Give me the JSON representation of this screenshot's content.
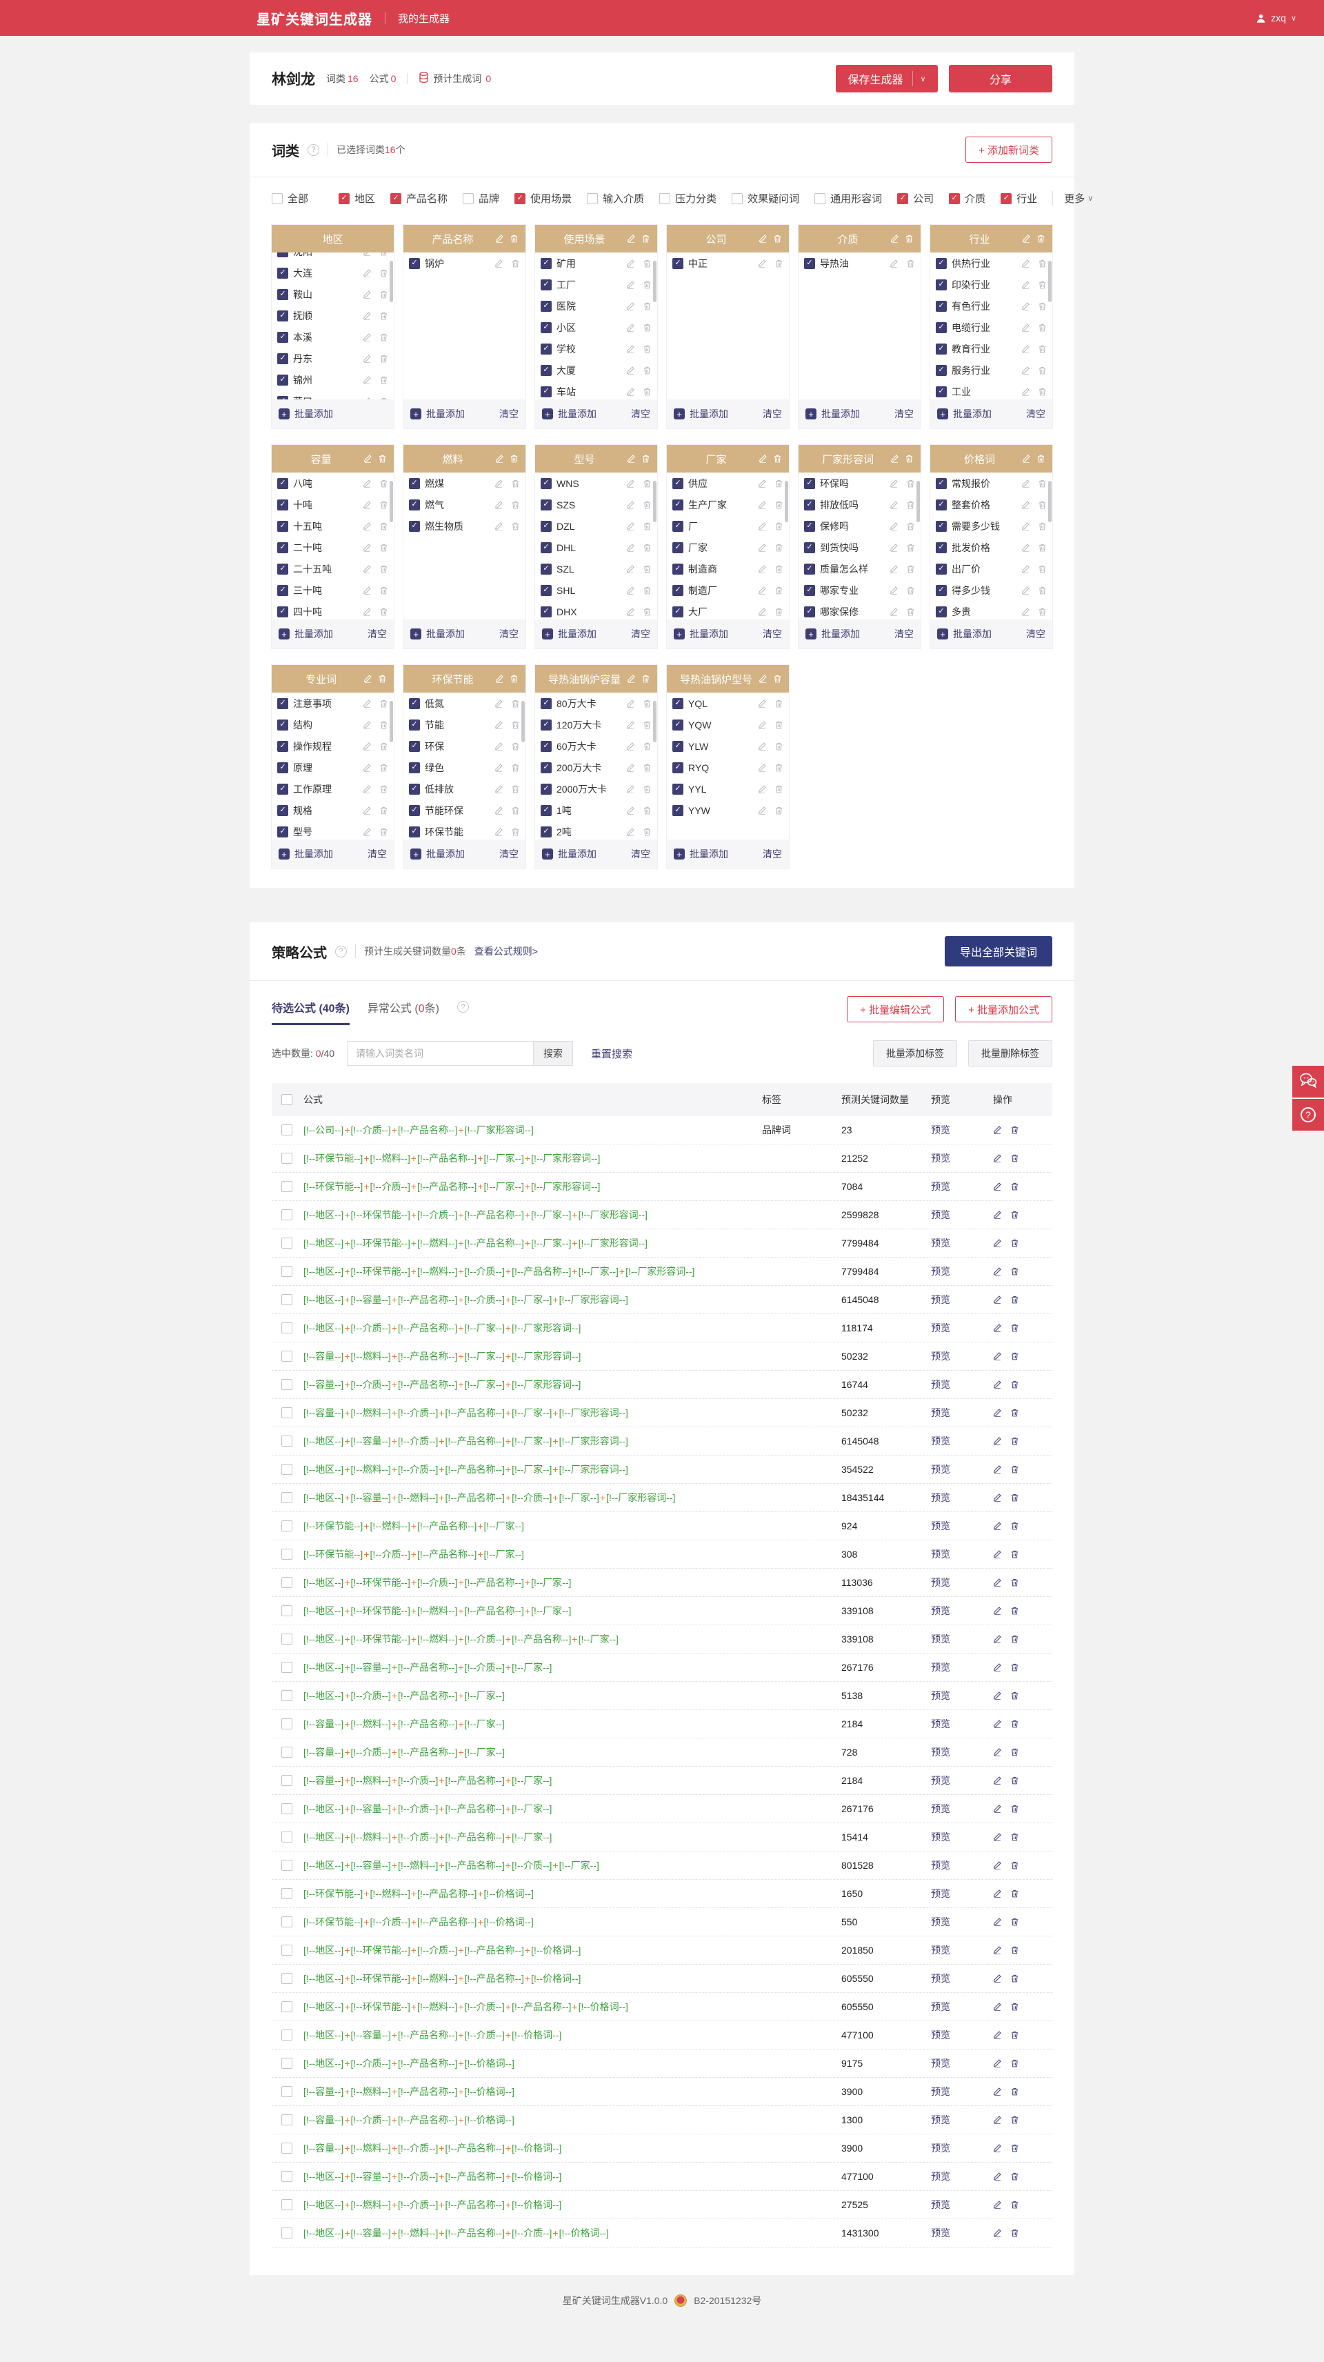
{
  "navbar": {
    "logo": "星矿关键词生成器",
    "menu": "我的生成器",
    "user": "zxq"
  },
  "header": {
    "name": "林剑龙",
    "wordclass_label": "词类",
    "wordclass_count": "16",
    "formula_label": "公式",
    "formula_count": "0",
    "estimate_label": "预计生成词",
    "estimate_count": "0",
    "save_button": "保存生成器",
    "share_button": "分享"
  },
  "wordclass": {
    "title": "词类",
    "selected_prefix": "已选择词类",
    "selected_count": "16",
    "selected_suffix": "个",
    "add_button": "+ 添加新词类",
    "more_label": "更多",
    "filters": [
      {
        "label": "全部",
        "checked": false,
        "divider_after": true
      },
      {
        "label": "地区",
        "checked": true
      },
      {
        "label": "产品名称",
        "checked": true
      },
      {
        "label": "品牌",
        "checked": false
      },
      {
        "label": "使用场景",
        "checked": true
      },
      {
        "label": "输入介质",
        "checked": false
      },
      {
        "label": "压力分类",
        "checked": false
      },
      {
        "label": "效果疑问词",
        "checked": false
      },
      {
        "label": "通用形容词",
        "checked": false
      },
      {
        "label": "公司",
        "checked": true
      },
      {
        "label": "介质",
        "checked": true
      },
      {
        "label": "行业",
        "checked": true
      }
    ],
    "batch_add_label": "批量添加",
    "clear_label": "清空",
    "cards": [
      {
        "title": "地区",
        "header_actions": false,
        "clear": false,
        "scrollbar": true,
        "clip_top": true,
        "items": [
          "沈阳",
          "大连",
          "鞍山",
          "抚顺",
          "本溪",
          "丹东",
          "锦州",
          "营口"
        ]
      },
      {
        "title": "产品名称",
        "header_actions": true,
        "clear": true,
        "scrollbar": false,
        "clip_top": false,
        "items": [
          "锅炉"
        ]
      },
      {
        "title": "使用场景",
        "header_actions": true,
        "clear": true,
        "scrollbar": true,
        "clip_top": false,
        "items": [
          "矿用",
          "工厂",
          "医院",
          "小区",
          "学校",
          "大厦",
          "车站"
        ]
      },
      {
        "title": "公司",
        "header_actions": true,
        "clear": true,
        "scrollbar": false,
        "clip_top": false,
        "items": [
          "中正"
        ]
      },
      {
        "title": "介质",
        "header_actions": true,
        "clear": true,
        "scrollbar": false,
        "clip_top": false,
        "items": [
          "导热油"
        ]
      },
      {
        "title": "行业",
        "header_actions": true,
        "clear": true,
        "scrollbar": true,
        "clip_top": false,
        "items": [
          "供热行业",
          "印染行业",
          "有色行业",
          "电缆行业",
          "教育行业",
          "服务行业",
          "工业"
        ]
      },
      {
        "title": "容量",
        "header_actions": true,
        "clear": true,
        "scrollbar": true,
        "clip_top": false,
        "items": [
          "八吨",
          "十吨",
          "十五吨",
          "二十吨",
          "二十五吨",
          "三十吨",
          "四十吨"
        ]
      },
      {
        "title": "燃料",
        "header_actions": true,
        "clear": true,
        "scrollbar": false,
        "clip_top": false,
        "items": [
          "燃煤",
          "燃气",
          "燃生物质"
        ]
      },
      {
        "title": "型号",
        "header_actions": true,
        "clear": true,
        "scrollbar": true,
        "clip_top": false,
        "items": [
          "WNS",
          "SZS",
          "DZL",
          "DHL",
          "SZL",
          "SHL",
          "DHX"
        ]
      },
      {
        "title": "厂家",
        "header_actions": true,
        "clear": true,
        "scrollbar": true,
        "clip_top": false,
        "items": [
          "供应",
          "生产厂家",
          "厂",
          "厂家",
          "制造商",
          "制造厂",
          "大厂"
        ]
      },
      {
        "title": "厂家形容词",
        "header_actions": true,
        "clear": true,
        "scrollbar": true,
        "clip_top": false,
        "items": [
          "环保吗",
          "排放低吗",
          "保修吗",
          "到货快吗",
          "质量怎么样",
          "哪家专业",
          "哪家保修"
        ]
      },
      {
        "title": "价格词",
        "header_actions": true,
        "clear": true,
        "scrollbar": true,
        "clip_top": false,
        "items": [
          "常规报价",
          "整套价格",
          "需要多少钱",
          "批发价格",
          "出厂价",
          "得多少钱",
          "多贵"
        ]
      },
      {
        "title": "专业词",
        "header_actions": true,
        "clear": true,
        "scrollbar": true,
        "clip_top": false,
        "items": [
          "注意事项",
          "结构",
          "操作规程",
          "原理",
          "工作原理",
          "规格",
          "型号"
        ]
      },
      {
        "title": "环保节能",
        "header_actions": true,
        "clear": true,
        "scrollbar": true,
        "clip_top": false,
        "items": [
          "低氮",
          "节能",
          "环保",
          "绿色",
          "低排放",
          "节能环保",
          "环保节能"
        ]
      },
      {
        "title": "导热油锅炉容量",
        "header_actions": true,
        "clear": true,
        "scrollbar": true,
        "clip_top": false,
        "items": [
          "80万大卡",
          "120万大卡",
          "60万大卡",
          "200万大卡",
          "2000万大卡",
          "1吨",
          "2吨"
        ]
      },
      {
        "title": "导热油锅炉型号",
        "header_actions": true,
        "clear": true,
        "scrollbar": false,
        "clip_top": false,
        "items": [
          "YQL",
          "YQW",
          "YLW",
          "RYQ",
          "YYL",
          "YYW"
        ]
      }
    ]
  },
  "formula": {
    "title": "策略公式",
    "estimate_prefix": "预计生成关键词数量",
    "estimate_count": "0",
    "estimate_suffix": "条",
    "rule_link": "查看公式规则>",
    "export_button": "导出全部关键词",
    "tab_active_prefix": "待选公式 (",
    "tab_active_count": "40条",
    "tab_active_suffix": ")",
    "tab_other_prefix": "异常公式 (",
    "tab_other_count": "0",
    "tab_other_suffix": "条)",
    "batch_edit_button": "+ 批量编辑公式",
    "batch_add_button": "+ 批量添加公式",
    "selected_label": "选中数量:",
    "selected_value": "0",
    "selected_total": "/40",
    "search_placeholder": "请输入词类名词",
    "search_button": "搜索",
    "reset_button": "重置搜索",
    "add_tag_button": "批量添加标签",
    "remove_tag_button": "批量删除标签",
    "columns": {
      "formula": "公式",
      "tag": "标签",
      "count": "预测关键词数量",
      "preview": "预览",
      "ops": "操作"
    },
    "preview_label": "预览",
    "rows": [
      {
        "parts": [
          "公司",
          "介质",
          "产品名称",
          "厂家形容词"
        ],
        "tag": "品牌词",
        "count": "23"
      },
      {
        "parts": [
          "环保节能",
          "燃料",
          "产品名称",
          "厂家",
          "厂家形容词"
        ],
        "tag": "",
        "count": "21252"
      },
      {
        "parts": [
          "环保节能",
          "介质",
          "产品名称",
          "厂家",
          "厂家形容词"
        ],
        "tag": "",
        "count": "7084"
      },
      {
        "parts": [
          "地区",
          "环保节能",
          "介质",
          "产品名称",
          "厂家",
          "厂家形容词"
        ],
        "tag": "",
        "count": "2599828"
      },
      {
        "parts": [
          "地区",
          "环保节能",
          "燃料",
          "产品名称",
          "厂家",
          "厂家形容词"
        ],
        "tag": "",
        "count": "7799484"
      },
      {
        "parts": [
          "地区",
          "环保节能",
          "燃料",
          "介质",
          "产品名称",
          "厂家",
          "厂家形容词"
        ],
        "tag": "",
        "count": "7799484"
      },
      {
        "parts": [
          "地区",
          "容量",
          "产品名称",
          "介质",
          "厂家",
          "厂家形容词"
        ],
        "tag": "",
        "count": "6145048"
      },
      {
        "parts": [
          "地区",
          "介质",
          "产品名称",
          "厂家",
          "厂家形容词"
        ],
        "tag": "",
        "count": "118174"
      },
      {
        "parts": [
          "容量",
          "燃料",
          "产品名称",
          "厂家",
          "厂家形容词"
        ],
        "tag": "",
        "count": "50232"
      },
      {
        "parts": [
          "容量",
          "介质",
          "产品名称",
          "厂家",
          "厂家形容词"
        ],
        "tag": "",
        "count": "16744"
      },
      {
        "parts": [
          "容量",
          "燃料",
          "介质",
          "产品名称",
          "厂家",
          "厂家形容词"
        ],
        "tag": "",
        "count": "50232"
      },
      {
        "parts": [
          "地区",
          "容量",
          "介质",
          "产品名称",
          "厂家",
          "厂家形容词"
        ],
        "tag": "",
        "count": "6145048"
      },
      {
        "parts": [
          "地区",
          "燃料",
          "介质",
          "产品名称",
          "厂家",
          "厂家形容词"
        ],
        "tag": "",
        "count": "354522"
      },
      {
        "parts": [
          "地区",
          "容量",
          "燃料",
          "产品名称",
          "介质",
          "厂家",
          "厂家形容词"
        ],
        "tag": "",
        "count": "18435144"
      },
      {
        "parts": [
          "环保节能",
          "燃料",
          "产品名称",
          "厂家"
        ],
        "tag": "",
        "count": "924"
      },
      {
        "parts": [
          "环保节能",
          "介质",
          "产品名称",
          "厂家"
        ],
        "tag": "",
        "count": "308"
      },
      {
        "parts": [
          "地区",
          "环保节能",
          "介质",
          "产品名称",
          "厂家"
        ],
        "tag": "",
        "count": "113036"
      },
      {
        "parts": [
          "地区",
          "环保节能",
          "燃料",
          "产品名称",
          "厂家"
        ],
        "tag": "",
        "count": "339108"
      },
      {
        "parts": [
          "地区",
          "环保节能",
          "燃料",
          "介质",
          "产品名称",
          "厂家"
        ],
        "tag": "",
        "count": "339108"
      },
      {
        "parts": [
          "地区",
          "容量",
          "产品名称",
          "介质",
          "厂家"
        ],
        "tag": "",
        "count": "267176"
      },
      {
        "parts": [
          "地区",
          "介质",
          "产品名称",
          "厂家"
        ],
        "tag": "",
        "count": "5138"
      },
      {
        "parts": [
          "容量",
          "燃料",
          "产品名称",
          "厂家"
        ],
        "tag": "",
        "count": "2184"
      },
      {
        "parts": [
          "容量",
          "介质",
          "产品名称",
          "厂家"
        ],
        "tag": "",
        "count": "728"
      },
      {
        "parts": [
          "容量",
          "燃料",
          "介质",
          "产品名称",
          "厂家"
        ],
        "tag": "",
        "count": "2184"
      },
      {
        "parts": [
          "地区",
          "容量",
          "介质",
          "产品名称",
          "厂家"
        ],
        "tag": "",
        "count": "267176"
      },
      {
        "parts": [
          "地区",
          "燃料",
          "介质",
          "产品名称",
          "厂家"
        ],
        "tag": "",
        "count": "15414"
      },
      {
        "parts": [
          "地区",
          "容量",
          "燃料",
          "产品名称",
          "介质",
          "厂家"
        ],
        "tag": "",
        "count": "801528"
      },
      {
        "parts": [
          "环保节能",
          "燃料",
          "产品名称",
          "价格词"
        ],
        "tag": "",
        "count": "1650"
      },
      {
        "parts": [
          "环保节能",
          "介质",
          "产品名称",
          "价格词"
        ],
        "tag": "",
        "count": "550"
      },
      {
        "parts": [
          "地区",
          "环保节能",
          "介质",
          "产品名称",
          "价格词"
        ],
        "tag": "",
        "count": "201850"
      },
      {
        "parts": [
          "地区",
          "环保节能",
          "燃料",
          "产品名称",
          "价格词"
        ],
        "tag": "",
        "count": "605550"
      },
      {
        "parts": [
          "地区",
          "环保节能",
          "燃料",
          "介质",
          "产品名称",
          "价格词"
        ],
        "tag": "",
        "count": "605550"
      },
      {
        "parts": [
          "地区",
          "容量",
          "产品名称",
          "介质",
          "价格词"
        ],
        "tag": "",
        "count": "477100"
      },
      {
        "parts": [
          "地区",
          "介质",
          "产品名称",
          "价格词"
        ],
        "tag": "",
        "count": "9175"
      },
      {
        "parts": [
          "容量",
          "燃料",
          "产品名称",
          "价格词"
        ],
        "tag": "",
        "count": "3900"
      },
      {
        "parts": [
          "容量",
          "介质",
          "产品名称",
          "价格词"
        ],
        "tag": "",
        "count": "1300"
      },
      {
        "parts": [
          "容量",
          "燃料",
          "介质",
          "产品名称",
          "价格词"
        ],
        "tag": "",
        "count": "3900"
      },
      {
        "parts": [
          "地区",
          "容量",
          "介质",
          "产品名称",
          "价格词"
        ],
        "tag": "",
        "count": "477100"
      },
      {
        "parts": [
          "地区",
          "燃料",
          "介质",
          "产品名称",
          "价格词"
        ],
        "tag": "",
        "count": "27525"
      },
      {
        "parts": [
          "地区",
          "容量",
          "燃料",
          "产品名称",
          "介质",
          "价格词"
        ],
        "tag": "",
        "count": "1431300"
      }
    ],
    "token_open": "[!--",
    "token_close": "--]",
    "token_join": "+"
  },
  "footer": {
    "version": "星矿关键词生成器V1.0.0",
    "icp": "B2-20151232号"
  },
  "colors": {
    "accent_red": "#d8404e",
    "navy": "#3e3e72",
    "tan": "#d3b384",
    "token_green": "#3fa13f",
    "plus_orange": "#e87a30",
    "export_navy": "#2f3b7c"
  }
}
